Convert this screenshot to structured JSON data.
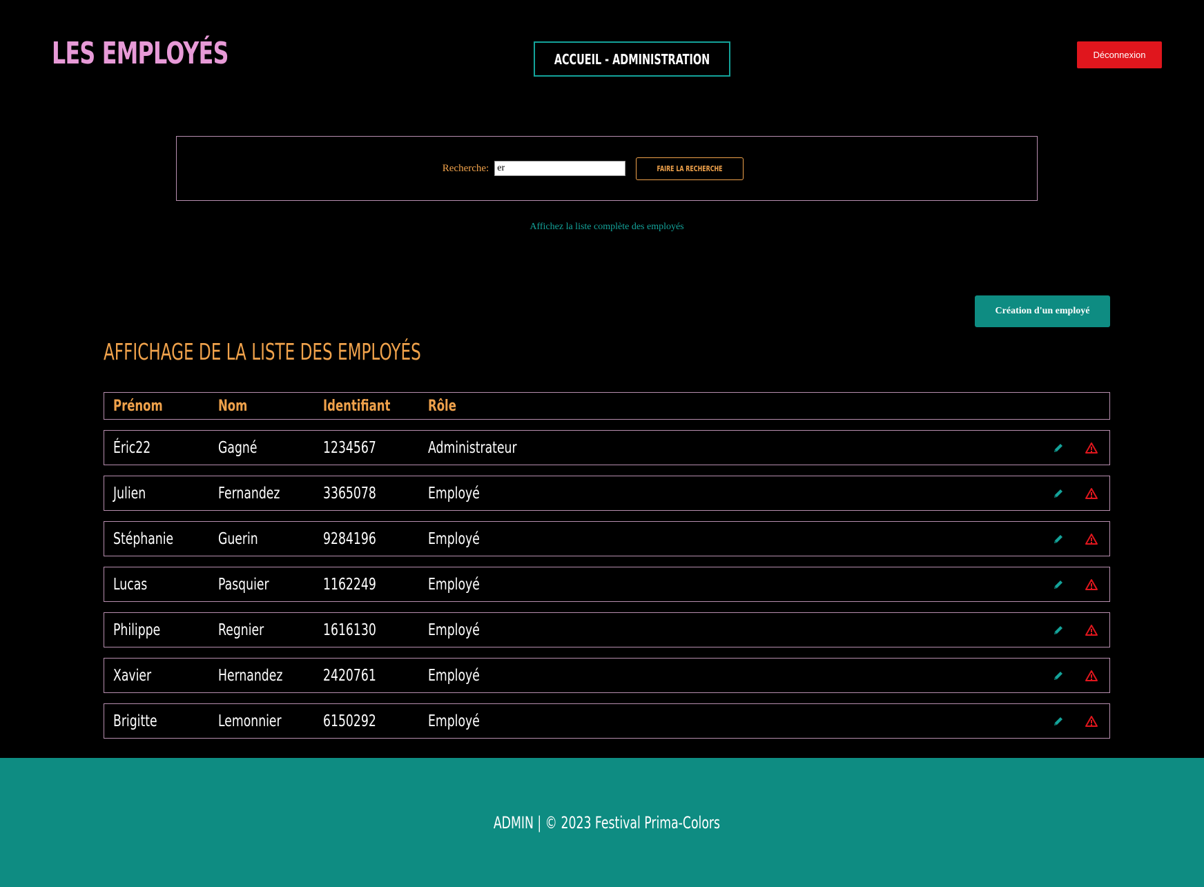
{
  "header": {
    "site_title": "LES EMPLOYÉS",
    "nav_label": "ACCUEIL - ADMINISTRATION",
    "logout_label": "Déconnexion"
  },
  "search": {
    "label": "Recherche:",
    "value": "er",
    "button_label": "FAIRE LA RECHERCHE",
    "full_list_link": "Affichez la liste complète des employés"
  },
  "create_button_label": "Création d'un employé",
  "section_title": "AFFICHAGE DE LA LISTE DES EMPLOYÉS",
  "table": {
    "columns": [
      "Prénom",
      "Nom",
      "Identifiant",
      "Rôle"
    ],
    "rows": [
      [
        "Éric22",
        "Gagné",
        "1234567",
        "Administrateur"
      ],
      [
        "Julien",
        "Fernandez",
        "3365078",
        "Employé"
      ],
      [
        "Stéphanie",
        "Guerin",
        "9284196",
        "Employé"
      ],
      [
        "Lucas",
        "Pasquier",
        "1162249",
        "Employé"
      ],
      [
        "Philippe",
        "Regnier",
        "1616130",
        "Employé"
      ],
      [
        "Xavier",
        "Hernandez",
        "2420761",
        "Employé"
      ],
      [
        "Brigitte",
        "Lemonnier",
        "6150292",
        "Employé"
      ]
    ],
    "row_actions": [
      "pencil-icon",
      "warning-triangle-icon"
    ]
  },
  "footer": {
    "text": "ADMIN | © 2023 Festival Prima-Colors"
  },
  "colors": {
    "title_pink": "#e79ad7",
    "accent_orange": "#f0a24b",
    "teal": "#0e8c82",
    "danger_red": "#e0161d",
    "border_mauve": "#b88fb0"
  }
}
